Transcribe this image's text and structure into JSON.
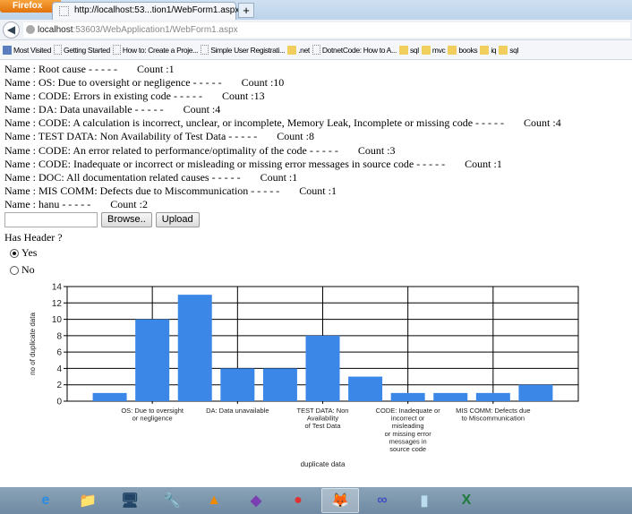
{
  "browser": {
    "menu_label": "Firefox",
    "tab_title": "http://localhost:53...tion1/WebForm1.aspx",
    "new_tab": "+",
    "url_host": "localhost",
    "url_rest": ":53603/WebApplication1/WebForm1.aspx",
    "bookmarks": [
      {
        "label": "Most Visited",
        "icon": "most-visited"
      },
      {
        "label": "Getting Started",
        "icon": "page"
      },
      {
        "label": "How to: Create a Proje...",
        "icon": "page"
      },
      {
        "label": "Simple User Registrati...",
        "icon": "page"
      },
      {
        "label": ".net",
        "icon": "folder"
      },
      {
        "label": "DotnetCode: How to A...",
        "icon": "page"
      },
      {
        "label": "sql",
        "icon": "folder"
      },
      {
        "label": "mvc",
        "icon": "folder"
      },
      {
        "label": "books",
        "icon": "folder"
      },
      {
        "label": "iq",
        "icon": "folder"
      },
      {
        "label": "sql",
        "icon": "folder"
      }
    ]
  },
  "rows": [
    {
      "name": "Name : Root cause - - - - -",
      "count": "Count :1"
    },
    {
      "name": "Name : OS: Due to oversight or negligence - - - - -",
      "count": "Count :10"
    },
    {
      "name": "Name : CODE: Errors in existing code - - - - -",
      "count": "Count :13"
    },
    {
      "name": "Name : DA: Data unavailable - - - - -",
      "count": "Count :4"
    },
    {
      "name": "Name : CODE: A calculation is incorrect, unclear, or incomplete, Memory Leak, Incomplete or missing code - - - - -",
      "count": "Count :4"
    },
    {
      "name": "Name : TEST DATA: Non Availability of Test Data - - - - -",
      "count": "Count :8"
    },
    {
      "name": "Name : CODE: An error related to performance/optimality of the code - - - - -",
      "count": "Count :3"
    },
    {
      "name": "Name : CODE: Inadequate or incorrect or misleading or missing error messages in source code - - - - -",
      "count": "Count :1"
    },
    {
      "name": "Name : DOC: All documentation related causes - - - - -",
      "count": "Count :1"
    },
    {
      "name": "Name : MIS COMM: Defects due to Miscommunication - - - - -",
      "count": "Count :1"
    },
    {
      "name": "Name : hanu - - - - -",
      "count": "Count :2"
    }
  ],
  "form": {
    "browse": "Browse..",
    "upload": "Upload",
    "has_header": "Has Header ?",
    "yes": "Yes",
    "no": "No"
  },
  "chart_data": {
    "type": "bar",
    "title": "",
    "xlabel": "duplicate data",
    "ylabel": "no of duplicate data",
    "ylim": [
      0,
      14
    ],
    "yticks": [
      0,
      2,
      4,
      6,
      8,
      10,
      12,
      14
    ],
    "grid": true,
    "categories": [
      "Root cause",
      "OS: Due to oversight or negligence",
      "CODE: Errors in existing code",
      "DA: Data unavailable",
      "CODE: A calculation is incorrect",
      "TEST DATA: Non Availability of Test Data",
      "CODE: An error related to performance",
      "CODE: Inadequate or incorrect or misleading or missing error messages in source code",
      "DOC: All documentation related causes",
      "MIS COMM: Defects due to Miscommunication",
      "hanu"
    ],
    "values": [
      1,
      10,
      13,
      4,
      4,
      8,
      3,
      1,
      1,
      1,
      2
    ],
    "shown_labels": [
      {
        "index": 1,
        "lines": [
          "OS: Due to oversight",
          "or negligence"
        ]
      },
      {
        "index": 3,
        "lines": [
          "DA: Data unavailable"
        ]
      },
      {
        "index": 5,
        "lines": [
          "TEST DATA: Non",
          "Availability",
          "of Test Data"
        ]
      },
      {
        "index": 7,
        "lines": [
          "CODE: Inadequate or",
          "incorrect or",
          "misleading",
          "or missing error",
          "messages in",
          "source code"
        ]
      },
      {
        "index": 9,
        "lines": [
          "MIS COMM: Defects due",
          "to Miscommunication"
        ]
      }
    ],
    "color": "#3b87e8"
  },
  "taskbar": [
    {
      "icon": "ie"
    },
    {
      "icon": "explorer"
    },
    {
      "icon": "remote-desktop"
    },
    {
      "icon": "tools"
    },
    {
      "icon": "vlc"
    },
    {
      "icon": "visual-studio"
    },
    {
      "icon": "chrome"
    },
    {
      "icon": "firefox",
      "active": true
    },
    {
      "icon": "app"
    },
    {
      "icon": "notepad"
    },
    {
      "icon": "excel"
    }
  ]
}
